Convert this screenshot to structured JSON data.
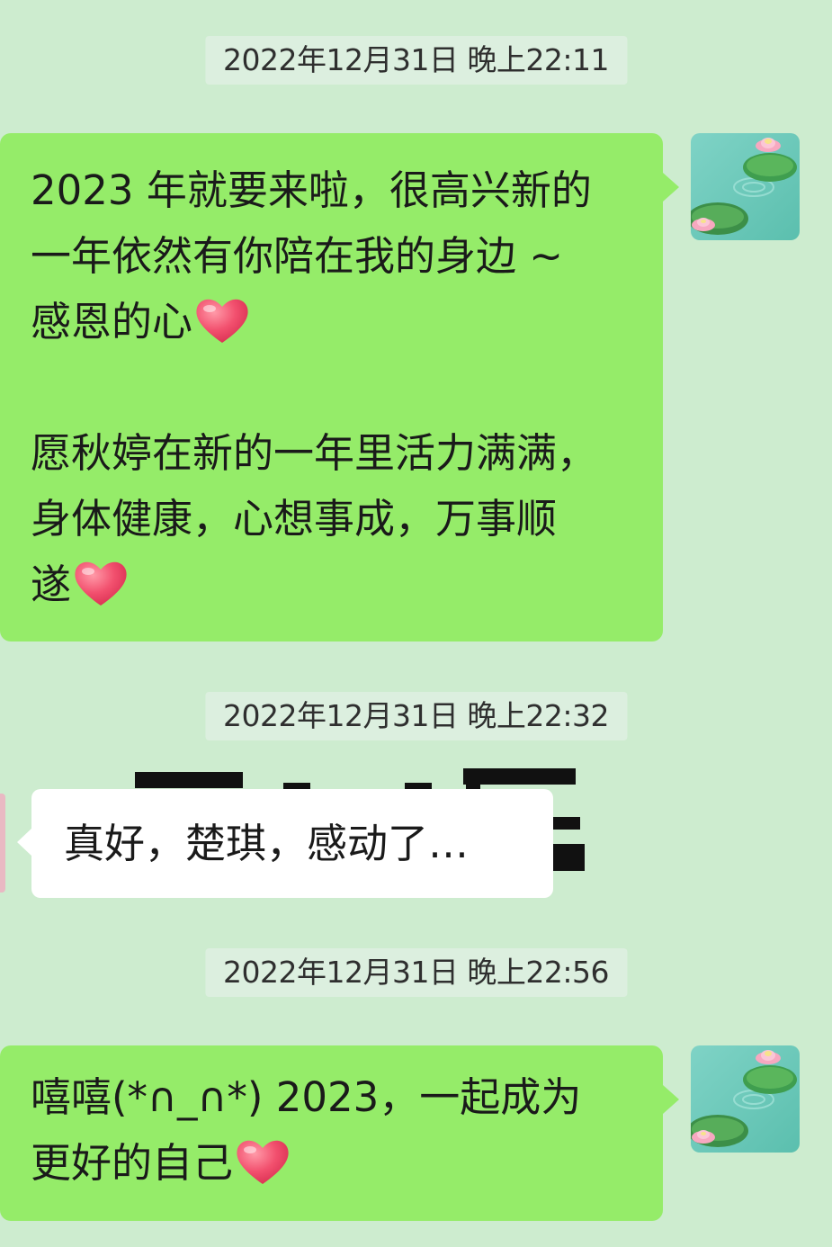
{
  "timestamps": [
    "2022年12月31日 晚上22:11",
    "2022年12月31日 晚上22:32",
    "2022年12月31日 晚上22:56"
  ],
  "messages": {
    "msg1": {
      "line1": "2023 年就要来啦，很高兴新的",
      "line2": "一年依然有你陪在我的身边 ~",
      "line3": "感恩的心",
      "line4": "",
      "line5": "愿秋婷在新的一年里活力满满，",
      "line6": "身体健康，心想事成，万事顺",
      "line7": "遂"
    },
    "msg2": {
      "text": "真好，楚琪，感动了…"
    },
    "msg3": {
      "line1": "嘻嘻(*∩_∩*) 2023，一起成为",
      "line2": "更好的自己"
    }
  },
  "colors": {
    "background": "#cdeccf",
    "outgoing_bubble": "#95ec69",
    "incoming_bubble": "#ffffff",
    "timestamp_bg": "#dcefdf",
    "heart": "#f0506e"
  },
  "icons": {
    "heart": "heart-emoji-icon",
    "avatar": "lotus-pond-avatar"
  }
}
